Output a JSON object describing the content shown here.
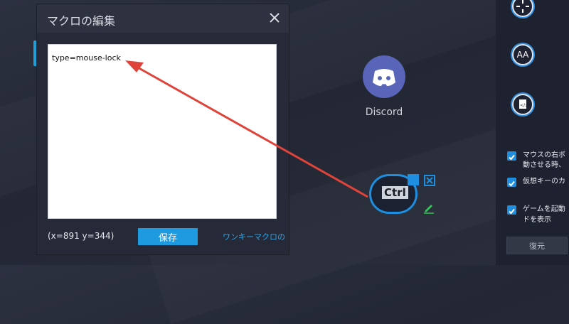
{
  "dialog": {
    "title": "マクロの編集",
    "editor_text": "type=mouse-lock",
    "coords": "(x=891  y=344)",
    "save_label": "保存",
    "link_label": "ワンキーマクロの"
  },
  "discord": {
    "label": "Discord"
  },
  "ctrl_key": {
    "label": "Ctrl"
  },
  "right_panel": {
    "icons": [
      {
        "name": "crosshair-icon",
        "text": ""
      },
      {
        "name": "aa-icon",
        "text": "AA"
      },
      {
        "name": "script-icon",
        "text": ""
      }
    ],
    "checkboxes": [
      {
        "line1": "マウスの右ボ",
        "line2": "動させる時、",
        "checked": true
      },
      {
        "line1": "仮想キーのカ",
        "line2": "",
        "checked": true
      },
      {
        "line1": "ゲームを起動",
        "line2": "ドを表示",
        "checked": true
      }
    ],
    "restore_label": "復元"
  },
  "colors": {
    "accent": "#1e8fe0",
    "arrow": "#e0433a",
    "discord": "#5865b8"
  }
}
